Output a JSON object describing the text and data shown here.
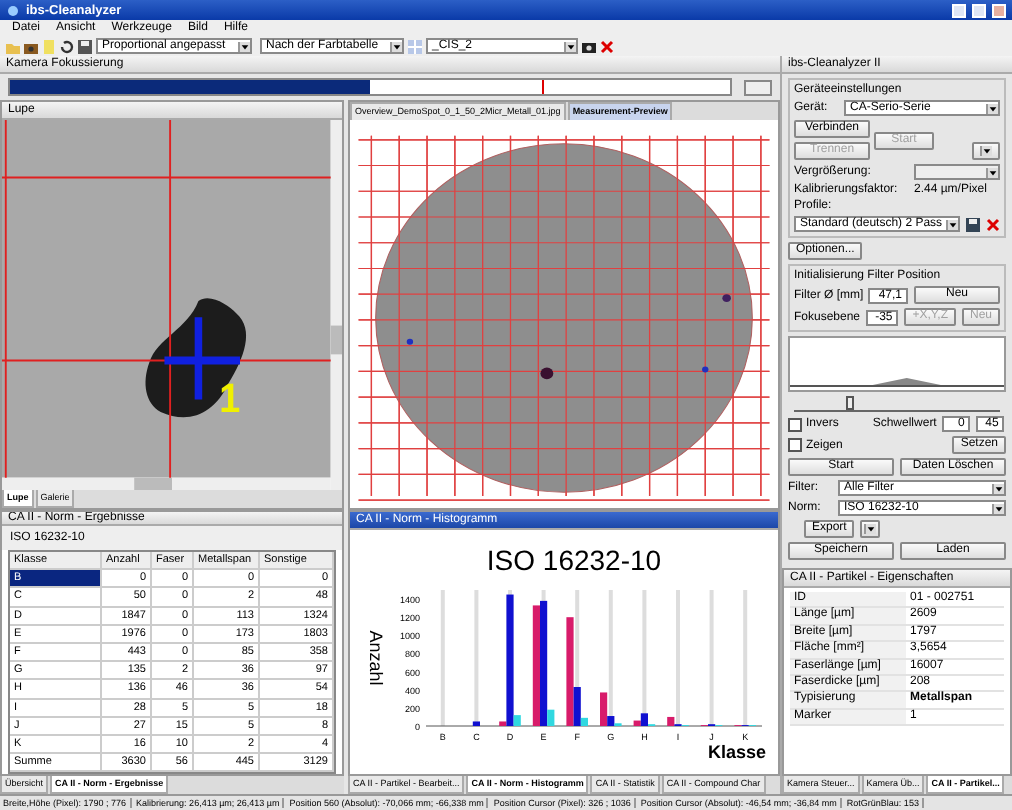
{
  "window": {
    "title": "ibs-Cleanalyzer"
  },
  "menu": [
    "Datei",
    "Ansicht",
    "Werkzeuge",
    "Bild",
    "Hilfe"
  ],
  "toolbar": {
    "fit_mode": "Proportional angepasst",
    "color_mode": "Nach der Farbtabelle",
    "camera": "_CIS_2"
  },
  "camera_focus": {
    "title": "Kamera Fokussierung",
    "level": 0.5
  },
  "lupe_panel": {
    "title": "Lupe",
    "marker_label": "1",
    "tabs": [
      {
        "label": "Lupe",
        "selected": true
      },
      {
        "label": "Galerie",
        "selected": false
      }
    ]
  },
  "preview_panel": {
    "tabs": [
      {
        "label": "Overview_DemoSpot_0_1_50_2Micr_Metall_01.jpg",
        "selected": false
      },
      {
        "label": "Measurement-Preview",
        "selected": true
      }
    ]
  },
  "results_panel": {
    "title": "CA II - Norm - Ergebnisse",
    "norm": "ISO 16232-10",
    "columns": [
      "Klasse",
      "Anzahl",
      "Faser",
      "Metallspan",
      "Sonstige"
    ],
    "rows": [
      {
        "cells": [
          "B",
          "0",
          "0",
          "0",
          "0"
        ],
        "selected": true
      },
      {
        "cells": [
          "C",
          "50",
          "0",
          "2",
          "48"
        ],
        "selected": false
      },
      {
        "cells": [
          "D",
          "1847",
          "0",
          "113",
          "1324"
        ],
        "selected": false
      },
      {
        "cells": [
          "E",
          "1976",
          "0",
          "173",
          "1803"
        ],
        "selected": false
      },
      {
        "cells": [
          "F",
          "443",
          "0",
          "85",
          "358"
        ],
        "selected": false
      },
      {
        "cells": [
          "G",
          "135",
          "2",
          "36",
          "97"
        ],
        "selected": false
      },
      {
        "cells": [
          "H",
          "136",
          "46",
          "36",
          "54"
        ],
        "selected": false
      },
      {
        "cells": [
          "I",
          "28",
          "5",
          "5",
          "18"
        ],
        "selected": false
      },
      {
        "cells": [
          "J",
          "27",
          "15",
          "5",
          "8"
        ],
        "selected": false
      },
      {
        "cells": [
          "K",
          "16",
          "10",
          "2",
          "4"
        ],
        "selected": false
      },
      {
        "cells": [
          "Summe",
          "3630",
          "56",
          "445",
          "3129"
        ],
        "selected": false
      }
    ]
  },
  "results_tabs": [
    {
      "label": "Übersicht",
      "selected": false
    },
    {
      "label": "CA II - Norm - Ergebnisse",
      "selected": true
    }
  ],
  "histogram_panel": {
    "title": "CA II - Norm - Histogramm",
    "chart_data": {
      "type": "bar",
      "title": "ISO 16232-10",
      "xlabel": "Klasse",
      "ylabel": "Anzahl",
      "categories": [
        "B",
        "C",
        "D",
        "E",
        "F",
        "G",
        "H",
        "I",
        "J",
        "K"
      ],
      "series": [
        {
          "color": "#d81b6a",
          "values": [
            0,
            0,
            50,
            1330,
            1200,
            370,
            60,
            100,
            10,
            10
          ]
        },
        {
          "color": "#1010d0",
          "values": [
            0,
            50,
            1450,
            1380,
            430,
            110,
            140,
            20,
            20,
            10
          ]
        },
        {
          "color": "#30d8e0",
          "values": [
            0,
            0,
            120,
            180,
            90,
            30,
            20,
            10,
            10,
            10
          ]
        }
      ],
      "grid": true,
      "ylim": [
        0,
        1500
      ],
      "yticks": [
        0,
        200,
        400,
        600,
        800,
        1000,
        1200,
        1400
      ]
    }
  },
  "center_tabs": [
    {
      "label": "CA II - Partikel - Bearbeit...",
      "selected": false
    },
    {
      "label": "CA II - Norm - Histogramm",
      "selected": true
    },
    {
      "label": "CA II - Statistik",
      "selected": false
    },
    {
      "label": "CA II - Compound Char",
      "selected": false
    }
  ],
  "device_panel": {
    "title": "ibs-Cleanalyzer II",
    "group_title": "Geräteeinstellungen",
    "device_label": "Gerät:",
    "device_value": "CA-Serio-Serie",
    "connect_button": {
      "label": "Verbinden",
      "disabled": false
    },
    "disconnect_button": {
      "label": "Trennen",
      "disabled": true
    },
    "start_button": {
      "label": "Start",
      "disabled": true
    },
    "zoom_label": "Vergrößerung:",
    "calibration_label": "Kalibrierungsfaktor:",
    "calibration_value": "2.44 µm/Pixel",
    "profile_label": "Profile:",
    "profile_value": "Standard (deutsch) 2 Pass",
    "options_button": {
      "label": "Optionen...",
      "disabled": false
    },
    "filter_group_title": "Initialisierung Filter Position",
    "diameter_label": "Filter Ø [mm]",
    "diameter_value": "47,1",
    "diameter_button": {
      "label": "Neu",
      "disabled": false
    },
    "focus_label": "Fokusebene",
    "focus_value": "-35",
    "xyz_button": {
      "label": "+X,Y,Z",
      "disabled": true
    },
    "focus_button": {
      "label": "Neu",
      "disabled": true
    },
    "threshold_slider": {
      "level": 0.27
    },
    "invert": {
      "label": "Invers",
      "checked": false
    },
    "show": {
      "label": "Zeigen",
      "checked": false
    },
    "threshold_label": "Schwellwert",
    "threshold_low": "0",
    "threshold_high": "45",
    "set_button": {
      "label": "Setzen",
      "disabled": false
    },
    "run_button": {
      "label": "Start",
      "disabled": false
    },
    "clear_button": {
      "label": "Daten Löschen",
      "disabled": false
    },
    "filter_label": "Filter:",
    "filter_value": "Alle Filter",
    "norm_label": "Norm:",
    "norm_value": "ISO 16232-10",
    "export_button": {
      "label": "Export",
      "disabled": false
    },
    "save_button": {
      "label": "Speichern",
      "disabled": false
    },
    "load_button": {
      "label": "Laden",
      "disabled": false
    }
  },
  "properties_panel": {
    "title": "CA II - Partikel - Eigenschaften",
    "rows": [
      {
        "label": "ID",
        "value": "01 - 002751",
        "bold": false
      },
      {
        "label": "Länge  [µm]",
        "value": "2609",
        "bold": false
      },
      {
        "label": "Breite  [µm]",
        "value": "1797",
        "bold": false
      },
      {
        "label": "Fläche  [mm²]",
        "value": "3,5654",
        "bold": false
      },
      {
        "label": "Faserlänge  [µm]",
        "value": "16007",
        "bold": false
      },
      {
        "label": "Faserdicke  [µm]",
        "value": "208",
        "bold": false
      },
      {
        "label": "Typisierung",
        "value": "Metallspan",
        "bold": true
      },
      {
        "label": "Marker",
        "value": "1",
        "bold": false
      }
    ]
  },
  "right_tabs": [
    {
      "label": "Kamera Steuer...",
      "selected": false
    },
    {
      "label": "Kamera Üb...",
      "selected": false
    },
    {
      "label": "CA II - Partikel...",
      "selected": true
    }
  ],
  "status_bar": [
    "Breite,Höhe (Pixel): 1790 ; 776",
    "Kalibrierung: 26,413 µm; 26,413 µm",
    "Position 560 (Absolut): -70,066 mm; -66,338 mm",
    "Position Cursor (Pixel): 326 ; 1036",
    "Position Cursor (Absolut): -46,54 mm; -36,84 mm",
    "RotGrünBlau: 153"
  ]
}
